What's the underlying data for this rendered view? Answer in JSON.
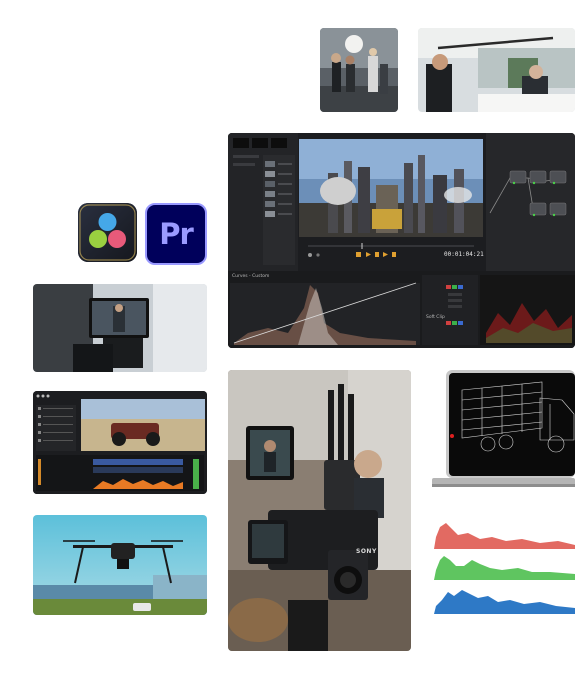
{
  "apps": {
    "resolve": {
      "icon": "davinci-resolve-icon"
    },
    "premiere": {
      "label": "Pr",
      "icon": "premiere-pro-icon"
    }
  },
  "resolve_ui": {
    "timecode": "00:01:04:21",
    "curves_label": "Curves - Custom",
    "soft_clip_label": "Soft Clip",
    "node_labels": [
      "01",
      "02",
      "03",
      "04",
      "05"
    ]
  },
  "camera": {
    "brand": "SONY"
  },
  "histograms": {
    "colors": [
      "#e26a62",
      "#5fc560",
      "#2e79c6"
    ]
  },
  "laptop": {
    "screen_content": "wireframe-truck"
  }
}
